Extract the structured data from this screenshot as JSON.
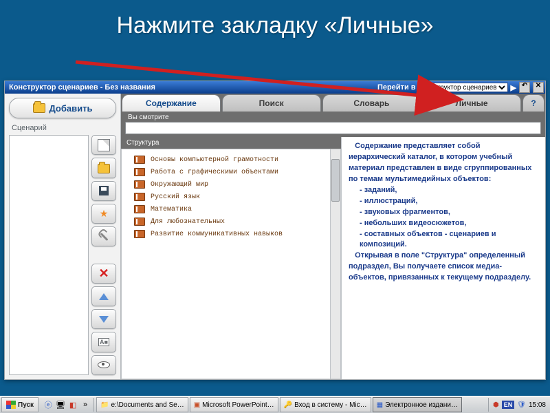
{
  "slide_title": "Нажмите закладку «Личные»",
  "titlebar": {
    "title": "Конструктор сценариев - Без названия",
    "goto_label": "Перейти в",
    "goto_value": "Конструктор сценариев"
  },
  "add_button": "Добавить",
  "scenario_label": "Сценарий",
  "tabs": {
    "content": "Содержание",
    "search": "Поиск",
    "dictionary": "Словарь",
    "personal": "Личные",
    "help": "?"
  },
  "viewing_label": "Вы смотрите",
  "structure_label": "Структура",
  "tree": [
    "Основы компьютерной грамотности",
    "Работа с графическими объектами",
    "Окружающий мир",
    "Русский язык",
    "Математика",
    "Для любознательных",
    "Развитие коммуникативных навыков"
  ],
  "description": {
    "p1": "Содержание представляет собой иерархический каталог, в котором учебный материал представлен в виде сгруппированных по темам мультимедийных объектов:",
    "b1": "- заданий,",
    "b2": "- иллюстраций,",
    "b3": "- звуковых фрагментов,",
    "b4": "- небольших видеосюжетов,",
    "b5": "- составных объектов - сценариев и композиций.",
    "p2": "Открывая в поле \"Структура\" определенный подраздел, Вы получаете список медиа-объектов, привязанных к текущему подразделу."
  },
  "taskbar": {
    "start": "Пуск",
    "tasks": [
      "e:\\Documents and Se…",
      "Microsoft PowerPoint…",
      "Вход в систему - Mic…",
      "Электронное издани…"
    ],
    "lang": "EN",
    "time": "15:08"
  }
}
